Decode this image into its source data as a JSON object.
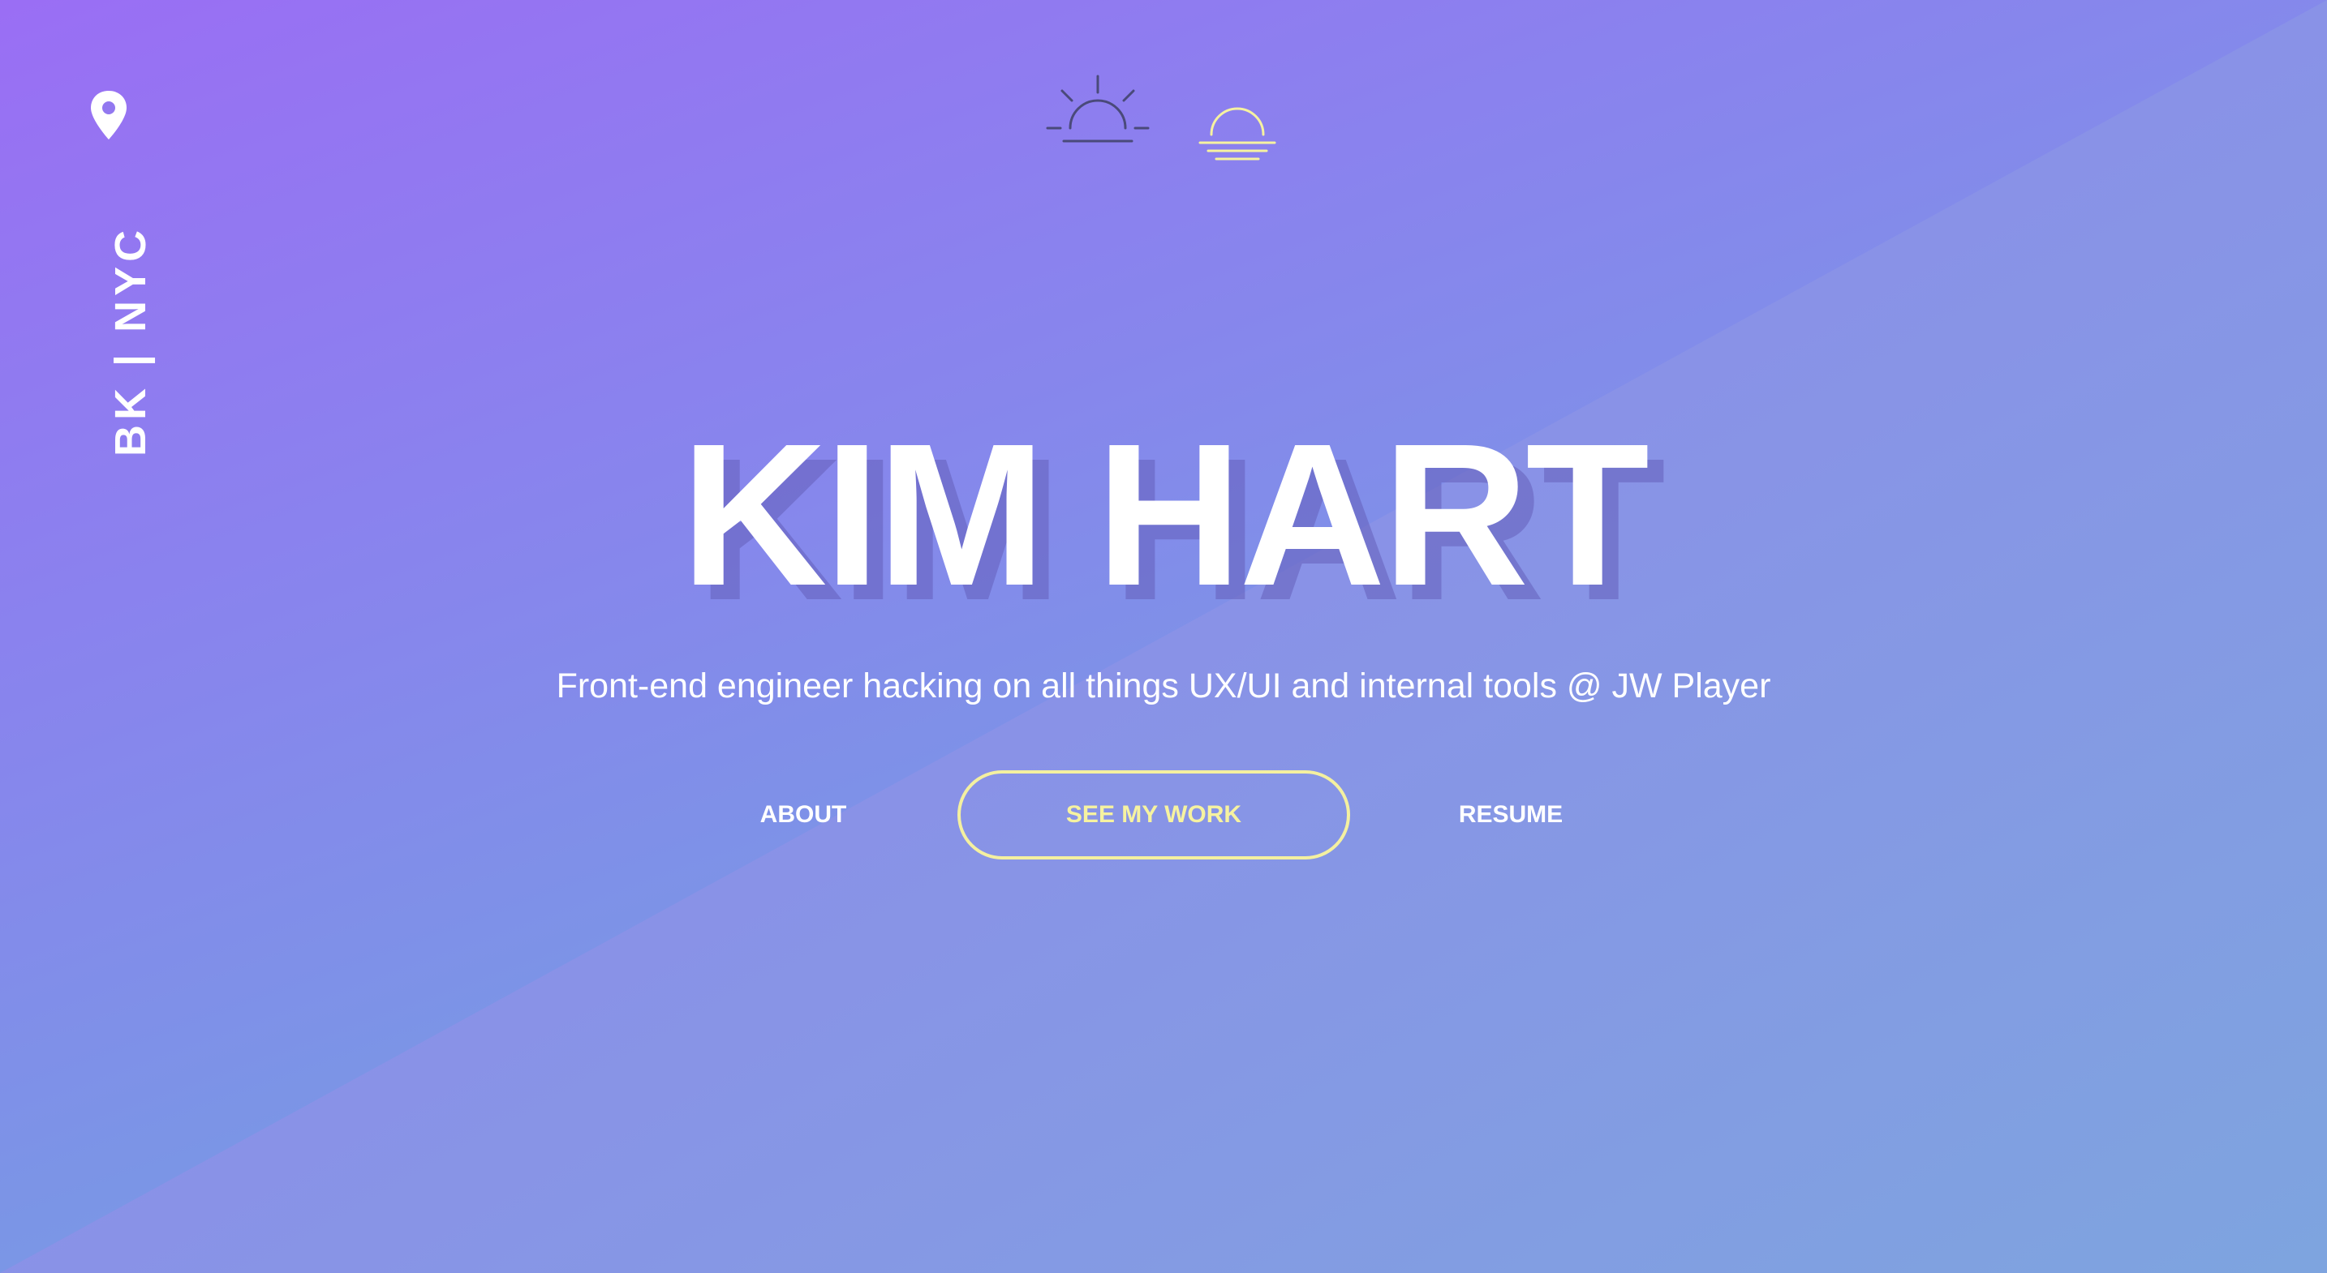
{
  "location": {
    "text": "BK | NYC",
    "icon": "map-pin-icon"
  },
  "theme_toggle": {
    "sunrise_icon": "sunrise-icon",
    "sunset_icon": "sunset-icon"
  },
  "hero": {
    "name": "KIM HART",
    "tagline": "Front-end engineer hacking on all things UX/UI and internal tools @ JW Player"
  },
  "nav": {
    "about": "ABOUT",
    "work": "SEE MY WORK",
    "resume": "RESUME"
  },
  "colors": {
    "gradient_start": "#9a6ef4",
    "gradient_end": "#7aa6de",
    "accent_yellow": "#f6f2a0",
    "text": "#ffffff"
  }
}
